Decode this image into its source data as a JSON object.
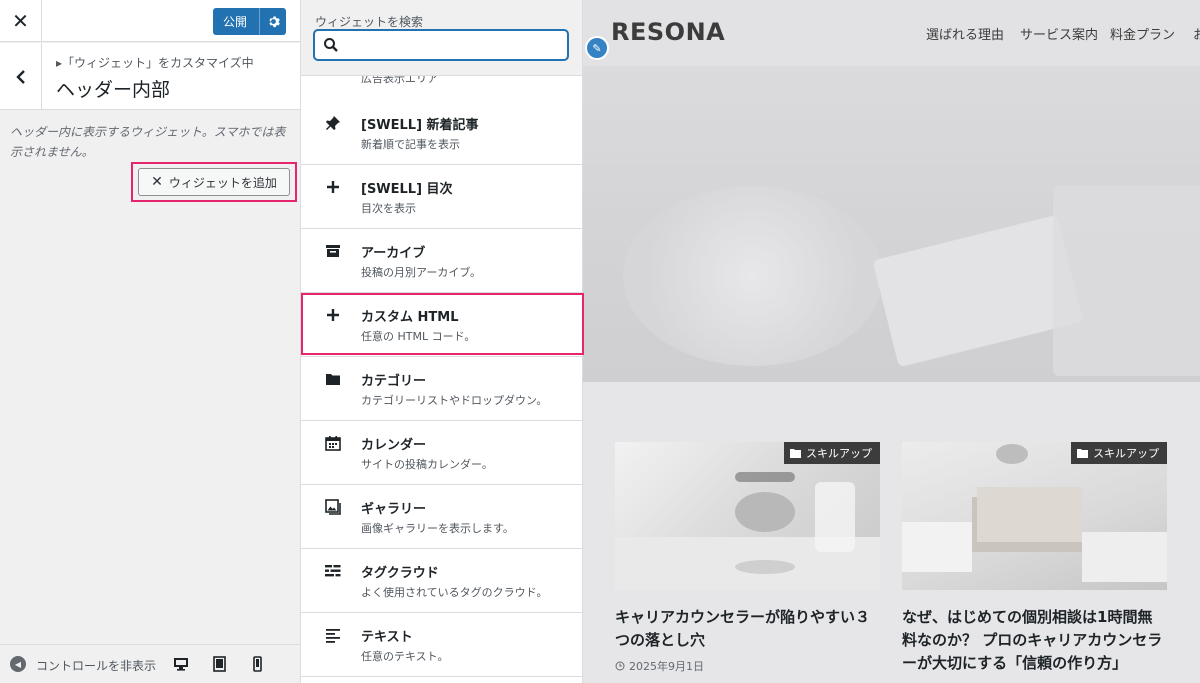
{
  "customizer": {
    "publish_label": "公開",
    "breadcrumb": "「ウィジェット」をカスタマイズ中",
    "section_title": "ヘッダー内部",
    "description": "ヘッダー内に表示するウィジェット。スマホでは表示されません。",
    "add_widget_label": "ウィジェットを追加",
    "collapse_label": "コントロールを非表示"
  },
  "widget_panel": {
    "search_label": "ウィジェットを検索",
    "search_value": "",
    "cut_item_desc": "広告表示エリア",
    "items": [
      {
        "title": "[SWELL] 新着記事",
        "desc": "新着順で記事を表示",
        "icon": "pin-icon"
      },
      {
        "title": "[SWELL] 目次",
        "desc": "目次を表示",
        "icon": "plus-icon"
      },
      {
        "title": "アーカイブ",
        "desc": "投稿の月別アーカイブ。",
        "icon": "archive-icon"
      },
      {
        "title": "カスタム HTML",
        "desc": "任意の HTML コード。",
        "icon": "plus-icon"
      },
      {
        "title": "カテゴリー",
        "desc": "カテゴリーリストやドロップダウン。",
        "icon": "folder-icon"
      },
      {
        "title": "カレンダー",
        "desc": "サイトの投稿カレンダー。",
        "icon": "calendar-icon"
      },
      {
        "title": "ギャラリー",
        "desc": "画像ギャラリーを表示します。",
        "icon": "gallery-icon"
      },
      {
        "title": "タグクラウド",
        "desc": "よく使用されているタグのクラウド。",
        "icon": "tagcloud-icon"
      },
      {
        "title": "テキスト",
        "desc": "任意のテキスト。",
        "icon": "text-icon"
      }
    ]
  },
  "preview": {
    "site_title": "RESONA",
    "nav": [
      "選ばれる理由",
      "サービス案内",
      "料金プラン",
      "お"
    ],
    "cards": [
      {
        "tag": "スキルアップ",
        "title": "キャリアカウンセラーが陥りやすい３つの落とし穴",
        "date": "2025年9月1日"
      },
      {
        "tag": "スキルアップ",
        "title": "なぜ、はじめての個別相談は1時間無料なのか？ プロのキャリアカウンセラーが大切にする「信頼の作り方」",
        "date": ""
      }
    ]
  }
}
